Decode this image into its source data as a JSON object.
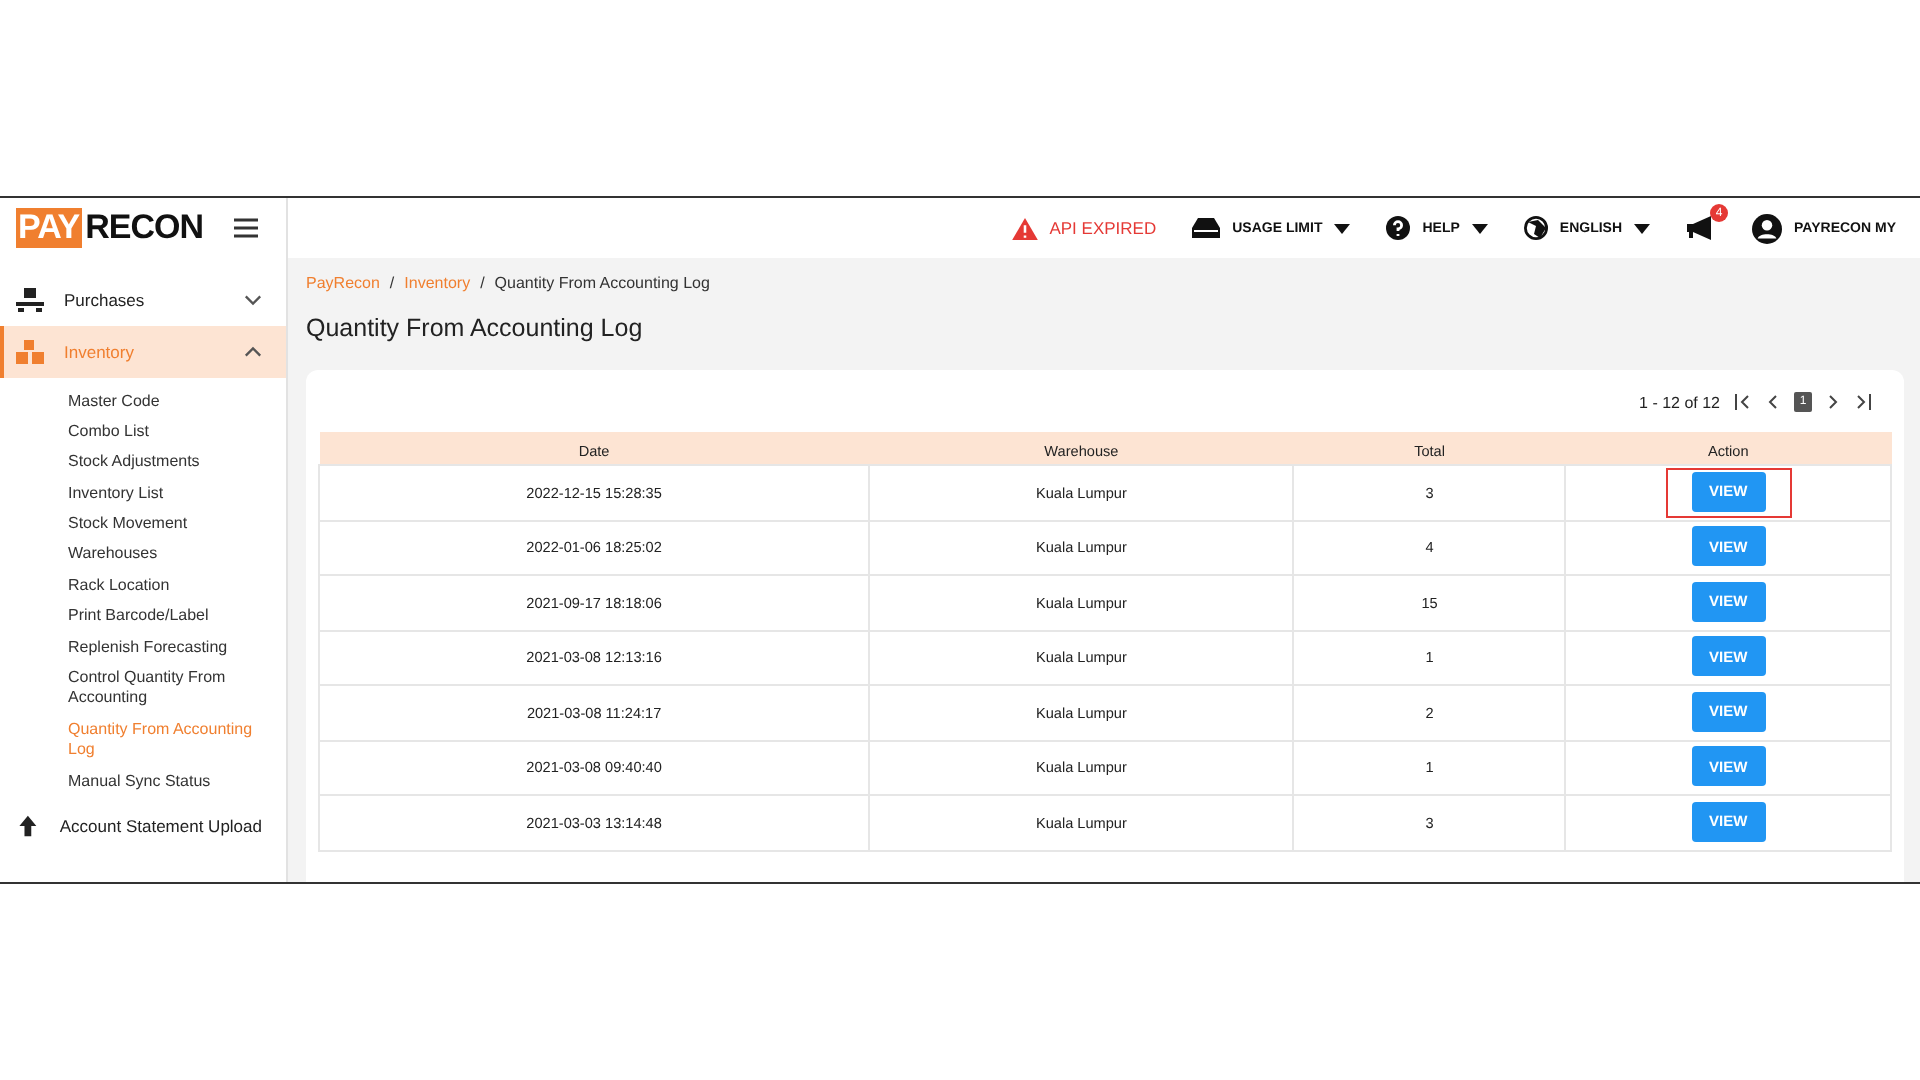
{
  "logo": {
    "part_1": "PAY",
    "part_2": "RECON"
  },
  "topbar": {
    "alert": "API EXPIRED",
    "menus": [
      {
        "label": "USAGE LIMIT",
        "kind": "drive"
      },
      {
        "label": "HELP",
        "kind": "help"
      },
      {
        "label": "ENGLISH",
        "kind": "globe"
      }
    ],
    "notification_count": "4",
    "user": "PAYRECON MY"
  },
  "sidebar": {
    "items": [
      {
        "label": "Purchases",
        "kind": "purchases",
        "expanded": false,
        "selected": false
      },
      {
        "label": "Inventory",
        "kind": "inventory",
        "expanded": true,
        "selected": true,
        "children": [
          {
            "label": "Master Code",
            "selected": false
          },
          {
            "label": "Combo List",
            "selected": false
          },
          {
            "label": "Stock Adjustments",
            "selected": false
          },
          {
            "label": "Inventory List",
            "selected": false
          },
          {
            "label": "Stock Movement",
            "selected": false
          },
          {
            "label": "Warehouses",
            "selected": false
          },
          {
            "label": "Rack Location",
            "selected": false
          },
          {
            "label": "Print Barcode/Label",
            "selected": false
          },
          {
            "label": "Replenish Forecasting",
            "selected": false
          },
          {
            "label": "Control Quantity From Accounting",
            "selected": false
          },
          {
            "label": "Quantity From Accounting Log",
            "selected": true
          },
          {
            "label": "Manual Sync Status",
            "selected": false
          }
        ]
      },
      {
        "label": "Account Statement Upload",
        "kind": "upload",
        "selected": false
      }
    ]
  },
  "breadcrumb": [
    {
      "label": "PayRecon",
      "link": true
    },
    {
      "separator": "/",
      "label": "Inventory",
      "link": true
    },
    {
      "separator": "/",
      "label": "Quantity From Accounting Log",
      "link": false
    }
  ],
  "title": "Quantity From Accounting Log",
  "pagination": {
    "range": "1 - 12 of 12",
    "pages": [
      {
        "label": "1",
        "selected": true
      }
    ]
  },
  "table": {
    "columns": [
      "Date",
      "Warehouse",
      "Total",
      "Action"
    ],
    "rows": [
      {
        "date": "2022-12-15 15:28:35",
        "warehouse": "Kuala Lumpur",
        "total": "3",
        "action": "VIEW",
        "highlighted": true
      },
      {
        "date": "2022-01-06 18:25:02",
        "warehouse": "Kuala Lumpur",
        "total": "4",
        "action": "VIEW",
        "highlighted": false
      },
      {
        "date": "2021-09-17 18:18:06",
        "warehouse": "Kuala Lumpur",
        "total": "15",
        "action": "VIEW",
        "highlighted": false
      },
      {
        "date": "2021-03-08 12:13:16",
        "warehouse": "Kuala Lumpur",
        "total": "1",
        "action": "VIEW",
        "highlighted": false
      },
      {
        "date": "2021-03-08 11:24:17",
        "warehouse": "Kuala Lumpur",
        "total": "2",
        "action": "VIEW",
        "highlighted": false
      },
      {
        "date": "2021-03-08 09:40:40",
        "warehouse": "Kuala Lumpur",
        "total": "1",
        "action": "VIEW",
        "highlighted": false
      },
      {
        "date": "2021-03-03 13:14:48",
        "warehouse": "Kuala Lumpur",
        "total": "3",
        "action": "VIEW",
        "highlighted": false
      }
    ]
  }
}
